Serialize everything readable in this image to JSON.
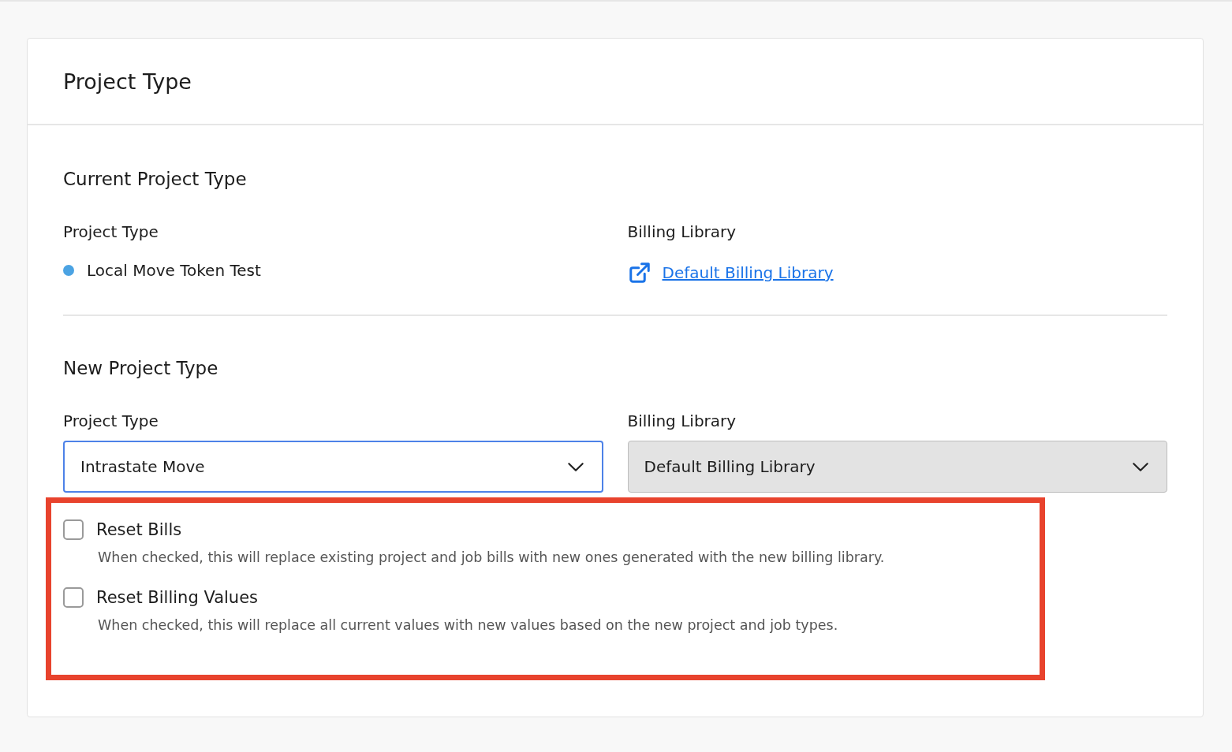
{
  "card": {
    "title": "Project Type"
  },
  "current": {
    "heading": "Current Project Type",
    "project_type": {
      "label": "Project Type",
      "value": "Local Move Token Test"
    },
    "billing_library": {
      "label": "Billing Library",
      "link": "Default Billing Library"
    }
  },
  "new": {
    "heading": "New Project Type",
    "fields": [
      {
        "label": "Project Type",
        "value": "Intrastate Move",
        "focused": true,
        "disabled": false
      },
      {
        "label": "Billing Library",
        "value": "Default Billing Library",
        "focused": false,
        "disabled": true
      }
    ]
  },
  "options": [
    {
      "label": "Reset Bills",
      "description": "When checked, this will replace existing project and job bills with new ones generated with the new billing library.",
      "checked": false
    },
    {
      "label": "Reset Billing Values",
      "description": "When checked, this will replace all current values with new values based on the new project and job types.",
      "checked": false
    }
  ]
}
